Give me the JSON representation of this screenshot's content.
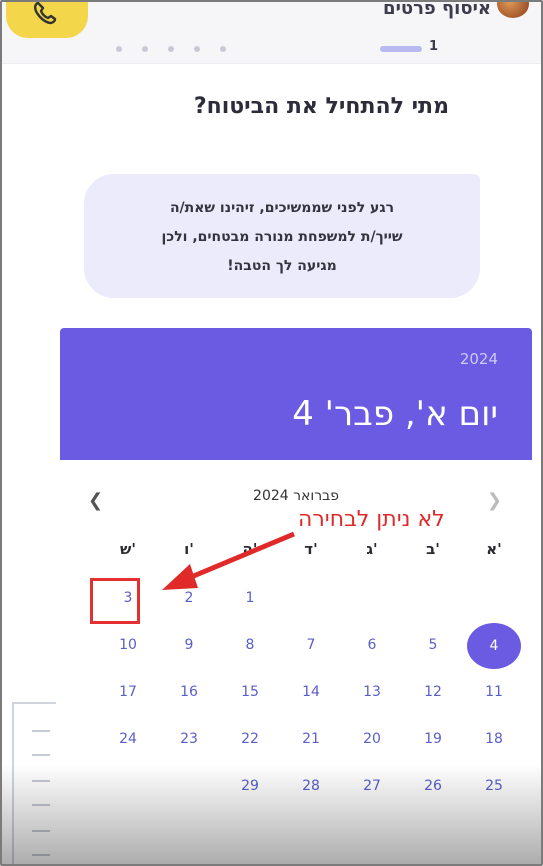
{
  "header": {
    "brand_text": "איסוף פרטים",
    "step_number": "1"
  },
  "page": {
    "title": "מתי להתחיל את הביטוח?",
    "bubble_lines": [
      "רגע לפני שממשיכים, זיהינו שאת/ה",
      "שייך/ת למשפחת מנורה מבטחים, ולכן",
      "מגיעה לך הטבה!"
    ]
  },
  "calendar": {
    "selected_year": "2024",
    "selected_date_label": "יום א', פבר' 4",
    "month_label": "פברואר 2024",
    "prev_icon": "chevron-left-icon",
    "next_icon": "chevron-right-icon",
    "weekdays": [
      "א'",
      "ב'",
      "ג'",
      "ד'",
      "ה'",
      "ו'",
      "ש'"
    ],
    "weeks": [
      [
        "",
        "",
        "",
        "",
        "1",
        "2",
        "3"
      ],
      [
        "4",
        "5",
        "6",
        "7",
        "8",
        "9",
        "10"
      ],
      [
        "11",
        "12",
        "13",
        "14",
        "15",
        "16",
        "17"
      ],
      [
        "18",
        "19",
        "20",
        "21",
        "22",
        "23",
        "24"
      ],
      [
        "25",
        "26",
        "27",
        "28",
        "29",
        "",
        ""
      ]
    ],
    "selected_day": "4"
  },
  "annotation": {
    "text": "לא ניתן לבחירה",
    "color": "#e02a2a"
  },
  "colors": {
    "accent": "#6a5be2",
    "phone_button": "#f3d64a",
    "bubble_bg": "#ebebfb"
  }
}
